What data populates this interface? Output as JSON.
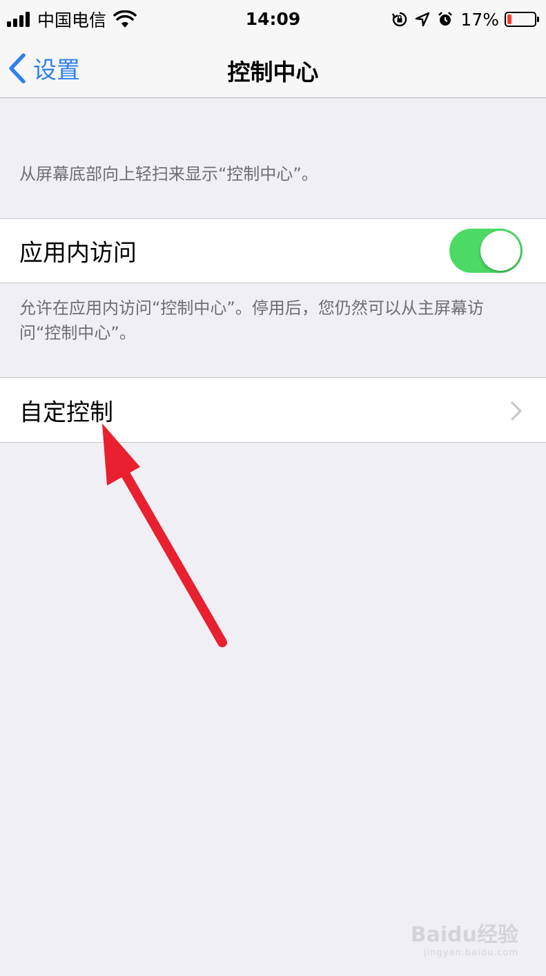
{
  "status_bar": {
    "carrier": "中国电信",
    "time": "14:09",
    "battery_percent": "17%",
    "battery_level": 0.17,
    "battery_color": "#ff3b30",
    "icons": [
      "signal-icon",
      "wifi-icon",
      "orientation-lock-icon",
      "location-icon",
      "alarm-icon",
      "battery-icon"
    ]
  },
  "nav": {
    "back_label": "设置",
    "title": "控制中心",
    "accent_color": "#2f80ed"
  },
  "section1": {
    "header_text": "从屏幕底部向上轻扫来显示“控制中心”。"
  },
  "in_app_access": {
    "label": "应用内访问",
    "enabled": true,
    "toggle_color": "#4cd964",
    "footer_text": "允许在应用内访问“控制中心”。停用后，您仍然可以从主屏幕访问“控制中心”。"
  },
  "customize": {
    "label": "自定控制"
  },
  "annotation": {
    "arrow_color": "#e8202f"
  },
  "watermark": {
    "logo_text": "Baidu经验",
    "url_text": "jingyan.baidu.com"
  }
}
